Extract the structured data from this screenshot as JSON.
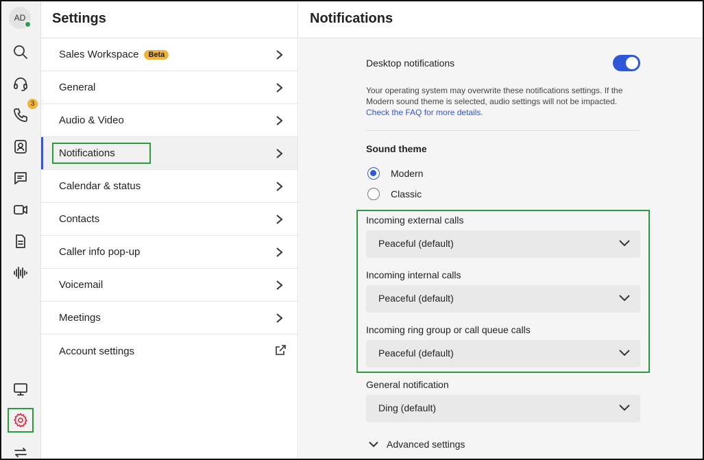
{
  "rail": {
    "avatar_initials": "AD",
    "phone_badge": "3",
    "icons": [
      "search-icon",
      "headset-icon",
      "phone-icon",
      "contacts-icon",
      "chat-icon",
      "video-icon",
      "document-icon",
      "audio-wave-icon",
      "monitor-icon",
      "gear-icon",
      "swap-arrows-icon"
    ]
  },
  "settings": {
    "title": "Settings",
    "items": [
      {
        "label": "Sales Workspace",
        "badge": "Beta"
      },
      {
        "label": "General"
      },
      {
        "label": "Audio & Video"
      },
      {
        "label": "Notifications"
      },
      {
        "label": "Calendar & status"
      },
      {
        "label": "Contacts"
      },
      {
        "label": "Caller info pop-up"
      },
      {
        "label": "Voicemail"
      },
      {
        "label": "Meetings"
      },
      {
        "label": "Account settings"
      }
    ]
  },
  "notifications": {
    "title": "Notifications",
    "desktop_label": "Desktop notifications",
    "desktop_enabled": true,
    "help_text": "Your operating system may overwrite these notifications settings. If the Modern sound theme is selected, audio settings will not be impacted.",
    "help_link": "Check the FAQ for more details.",
    "sound_theme_title": "Sound theme",
    "theme_modern": "Modern",
    "theme_classic": "Classic",
    "selected_theme": "Modern",
    "external_label": "Incoming external calls",
    "external_value": "Peaceful (default)",
    "internal_label": "Incoming internal calls",
    "internal_value": "Peaceful (default)",
    "group_label": "Incoming ring group or call queue calls",
    "group_value": "Peaceful (default)",
    "general_label": "General notification",
    "general_value": "Ding (default)",
    "advanced_label": "Advanced settings"
  },
  "colors": {
    "accent": "#2d56d8",
    "highlight_box": "#2a9a3a",
    "badge": "#f0b43c",
    "presence": "#2e9e4f"
  }
}
